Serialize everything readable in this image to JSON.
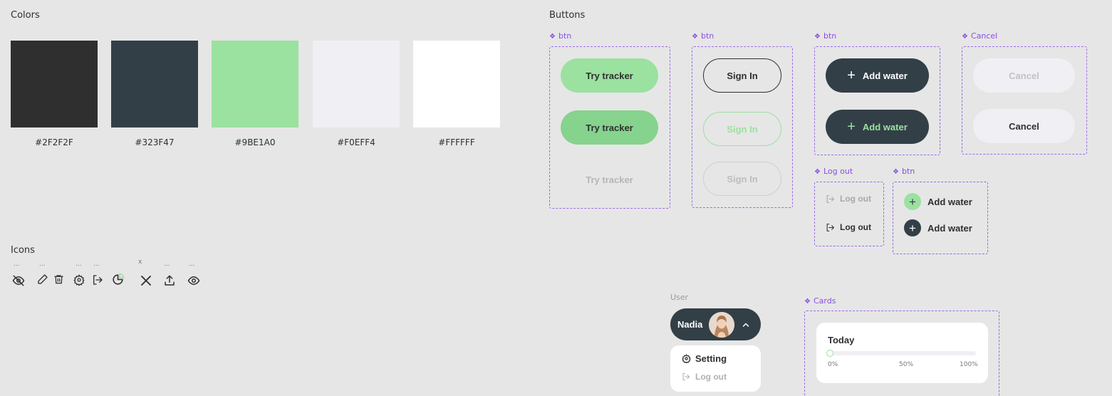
{
  "colors": {
    "title": "Colors",
    "swatches": [
      {
        "hex": "#2F2F2F",
        "label": "#2F2F2F"
      },
      {
        "hex": "#323F47",
        "label": "#323F47"
      },
      {
        "hex": "#9BE1A0",
        "label": "#9BE1A0"
      },
      {
        "hex": "#F0EFF4",
        "label": "#F0EFF4"
      },
      {
        "hex": "#FFFFFF",
        "label": "#FFFFFF"
      }
    ]
  },
  "icons": {
    "title": "Icons",
    "items": [
      {
        "name": "eye-off-icon",
        "caption": "..."
      },
      {
        "name": "pencil-icon",
        "caption": "..."
      },
      {
        "name": "trash-icon",
        "caption": ""
      },
      {
        "name": "gear-icon",
        "caption": "..."
      },
      {
        "name": "logout-icon",
        "caption": "..."
      },
      {
        "name": "pie-chart-icon",
        "caption": ""
      },
      {
        "name": "close-icon",
        "caption": "x"
      },
      {
        "name": "upload-icon",
        "caption": "..."
      },
      {
        "name": "eye-icon",
        "caption": "..."
      }
    ]
  },
  "buttons": {
    "title": "Buttons",
    "groups": {
      "try": {
        "label": "btn",
        "items": [
          "Try tracker",
          "Try tracker",
          "Try tracker"
        ]
      },
      "signin": {
        "label": "btn",
        "items": [
          "Sign In",
          "Sign In",
          "Sign In"
        ]
      },
      "addwater": {
        "label": "btn",
        "items": [
          "Add water",
          "Add water"
        ]
      },
      "cancel": {
        "label": "Cancel",
        "items": [
          "Cancel",
          "Cancel"
        ]
      },
      "logout": {
        "label": "Log out",
        "items": [
          "Log out",
          "Log out"
        ]
      },
      "addwater_small": {
        "label": "btn",
        "items": [
          "Add water",
          "Add water"
        ]
      }
    }
  },
  "user": {
    "section_label": "User",
    "name": "Nadia",
    "menu": {
      "setting": "Setting",
      "logout": "Log out"
    }
  },
  "cards": {
    "label": "Cards",
    "card": {
      "title": "Today",
      "progress": 0,
      "ticks": [
        "0%",
        "50%",
        "100%"
      ]
    }
  }
}
